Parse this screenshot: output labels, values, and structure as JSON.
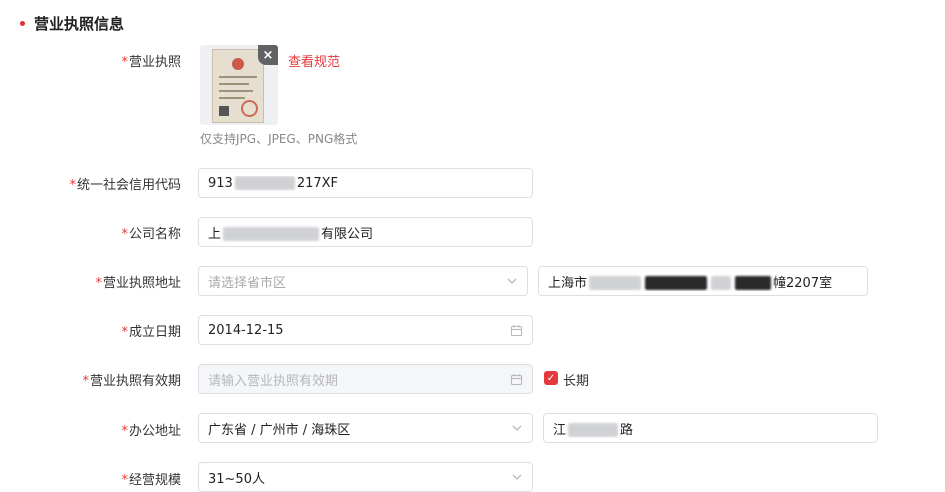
{
  "section": {
    "title": "营业执照信息"
  },
  "required_mark": "*",
  "license": {
    "label": "营业执照",
    "view_link": "查看规范",
    "hint": "仅支持JPG、JPEG、PNG格式",
    "remove_icon": "×"
  },
  "credit_code": {
    "label": "统一社会信用代码",
    "value_start": "913",
    "value_end": "217XF"
  },
  "company_name": {
    "label": "公司名称",
    "value_start": "上",
    "value_end": "有限公司"
  },
  "license_address": {
    "label": "营业执照地址",
    "region_placeholder": "请选择省市区",
    "detail_start": "上海市",
    "detail_end": "幢2207室"
  },
  "established": {
    "label": "成立日期",
    "value": "2014-12-15"
  },
  "validity": {
    "label": "营业执照有效期",
    "placeholder": "请输入营业执照有效期",
    "long_term_label": "长期",
    "long_term_checked": true
  },
  "office_address": {
    "label": "办公地址",
    "region_value": "广东省 / 广州市 / 海珠区",
    "detail_start": "江",
    "detail_end": "路"
  },
  "scale": {
    "label": "经营规模",
    "value": "31~50人"
  },
  "icons": {
    "dropdown": "chevron-down-icon",
    "calendar": "calendar-icon",
    "check": "check-icon",
    "close": "close-icon"
  },
  "colors": {
    "accent": "#e4393c",
    "border": "#dcdfe6",
    "disabled_bg": "#f5f6f7"
  }
}
